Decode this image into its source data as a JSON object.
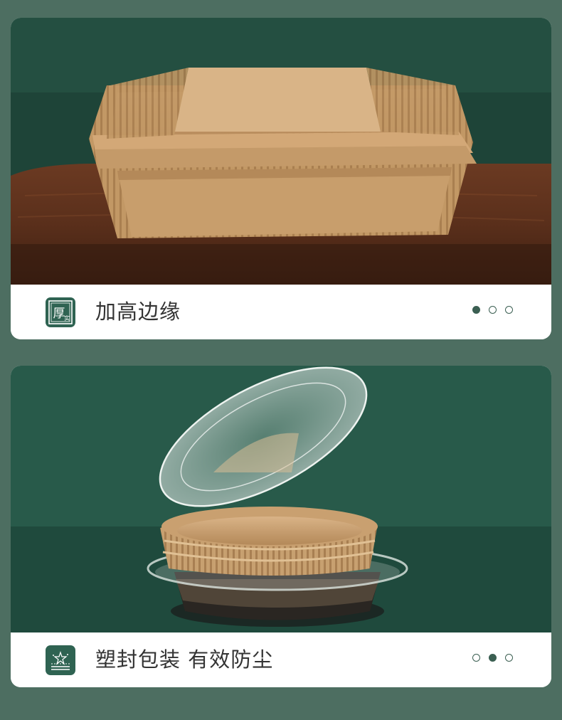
{
  "background_color": "#4d6e61",
  "accent_color": "#2f6352",
  "cards": [
    {
      "image": "stacked-rectangular-kraft-paper-liners-on-wooden-board",
      "badge_icon": "thick-stamp-icon",
      "badge_text": "厚",
      "badge_subtext": "实",
      "caption": "加高边缘",
      "dots": 3,
      "active_dot": 1
    },
    {
      "image": "round-paper-liners-in-clear-plastic-container-with-open-lid",
      "badge_icon": "sealed-package-icon",
      "caption": "塑封包装 有效防尘",
      "dots": 3,
      "active_dot": 2
    }
  ]
}
